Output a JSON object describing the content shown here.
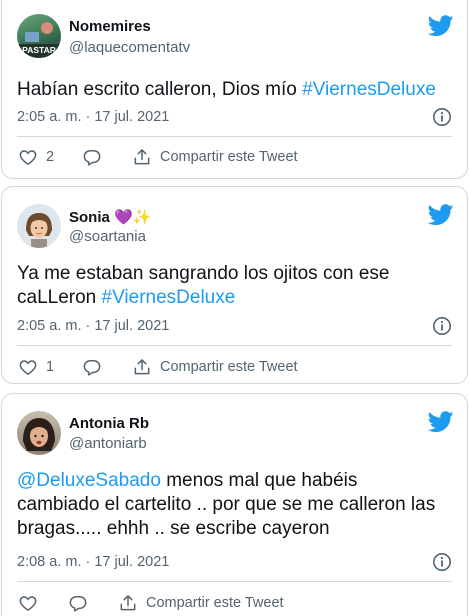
{
  "tweets": [
    {
      "name": "Nomemires",
      "handle": "@laquecomentatv",
      "avatar_caption": "PASTAR",
      "text_parts": [
        "Habían escrito calleron, Dios mío ",
        "#ViernesDeluxe"
      ],
      "time": "2:05 a. m. · 17 jul. 2021",
      "likes": "2",
      "share_label": "Compartir este Tweet"
    },
    {
      "name": "Sonia",
      "name_emojis": "💜✨",
      "handle": "@soartania",
      "text_line1": "Ya me estaban sangrando los ojitos con ese",
      "text_line2_parts": [
        "caLLeron ",
        "#ViernesDeluxe"
      ],
      "time": "2:05 a. m. · 17 jul. 2021",
      "likes": "1",
      "share_label": "Compartir este Tweet"
    },
    {
      "name": "Antonia Rb",
      "handle": "@antoniarb",
      "mention": "@DeluxeSabado",
      "text_line1_rest": " menos mal que habéis",
      "text_line2": "cambiado el cartelito .. por que se me calleron las",
      "text_line3": "bragas..... ehhh .. se escribe cayeron",
      "time": "2:08 a. m. · 17 jul. 2021",
      "share_label": "Compartir este Tweet"
    }
  ],
  "colors": {
    "accent": "#1d9bf0",
    "text": "#0f1419",
    "muted": "#536471",
    "border": "#cfd9de"
  },
  "icons": [
    "twitter-bird-icon",
    "info-icon",
    "heart-icon",
    "reply-icon",
    "share-icon"
  ]
}
